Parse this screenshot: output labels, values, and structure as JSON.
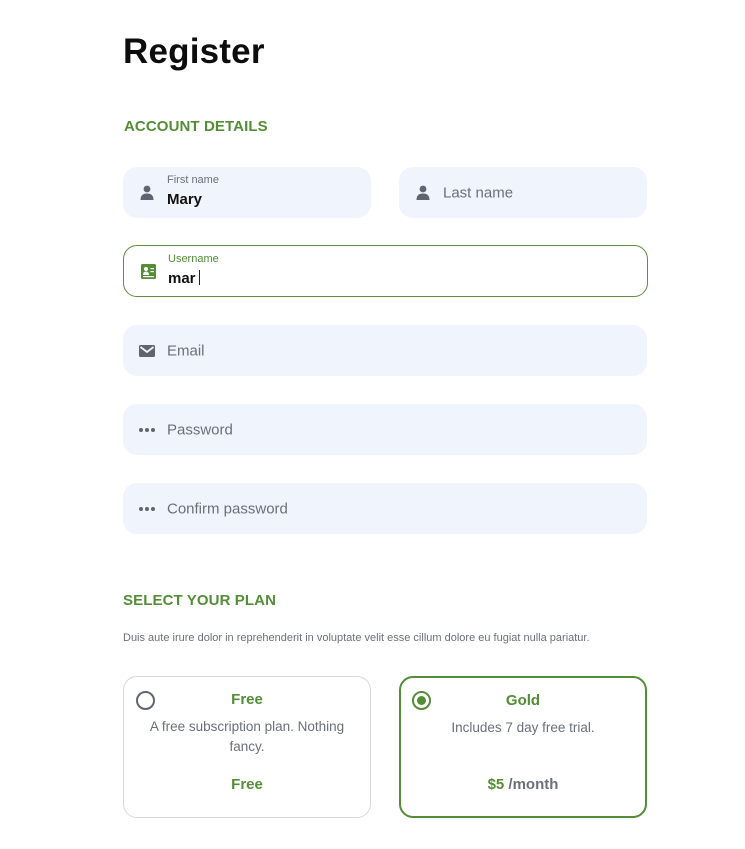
{
  "page": {
    "title": "Register"
  },
  "colors": {
    "accent": "#538d36",
    "field_bg": "#f0f4fc",
    "muted_text": "#6b6f78"
  },
  "account": {
    "heading": "ACCOUNT DETAILS",
    "first_name": {
      "label": "First name",
      "value": "Mary",
      "icon": "user-icon"
    },
    "last_name": {
      "placeholder": "Last name",
      "icon": "user-icon"
    },
    "username": {
      "label": "Username",
      "value": "mar",
      "icon": "id-card-icon",
      "focused": true
    },
    "email": {
      "placeholder": "Email",
      "icon": "envelope-icon"
    },
    "password": {
      "placeholder": "Password",
      "icon": "dots-icon"
    },
    "confirm_password": {
      "placeholder": "Confirm password",
      "icon": "dots-icon"
    }
  },
  "plan": {
    "heading": "SELECT YOUR PLAN",
    "description": "Duis aute irure dolor in reprehenderit in voluptate velit esse cillum dolore eu fugiat nulla pariatur.",
    "options": [
      {
        "name": "Free",
        "description": "A free subscription plan. Nothing fancy.",
        "price": "Free",
        "period": "",
        "selected": false
      },
      {
        "name": "Gold",
        "description": "Includes 7 day free trial.",
        "price": "$5",
        "period": "/month",
        "selected": true
      }
    ]
  }
}
